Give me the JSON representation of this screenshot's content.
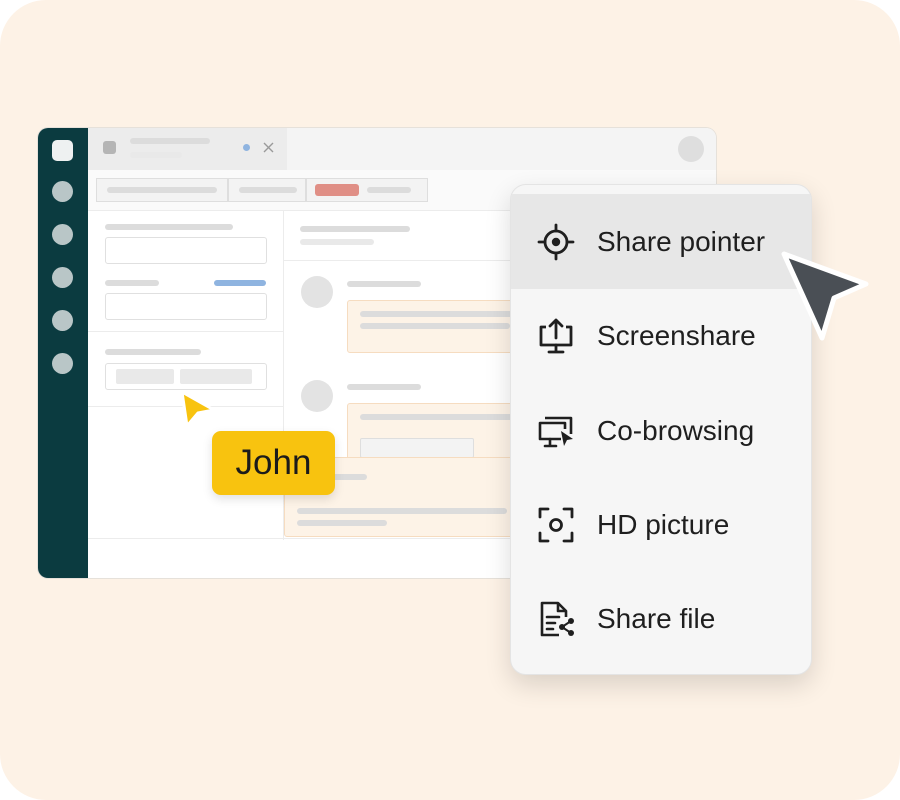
{
  "collaborator": {
    "name": "John",
    "tag_color": "#f8c30f"
  },
  "menu": {
    "items": [
      {
        "label": "Share pointer",
        "icon": "crosshair-icon",
        "active": true
      },
      {
        "label": "Screenshare",
        "icon": "monitor-upload-icon",
        "active": false
      },
      {
        "label": "Co-browsing",
        "icon": "cobrowse-icon",
        "active": false
      },
      {
        "label": "HD picture",
        "icon": "camera-focus-icon",
        "active": false
      },
      {
        "label": "Share file",
        "icon": "file-share-icon",
        "active": false
      }
    ]
  },
  "colors": {
    "background": "#fdf2e6",
    "sidebar": "#0b3b40",
    "menu_bg": "#f6f6f6",
    "menu_active": "#e7e7e7",
    "pointer": "#4a4f55",
    "accent_red": "#e08f86",
    "accent_blue": "#8fb4e0"
  }
}
